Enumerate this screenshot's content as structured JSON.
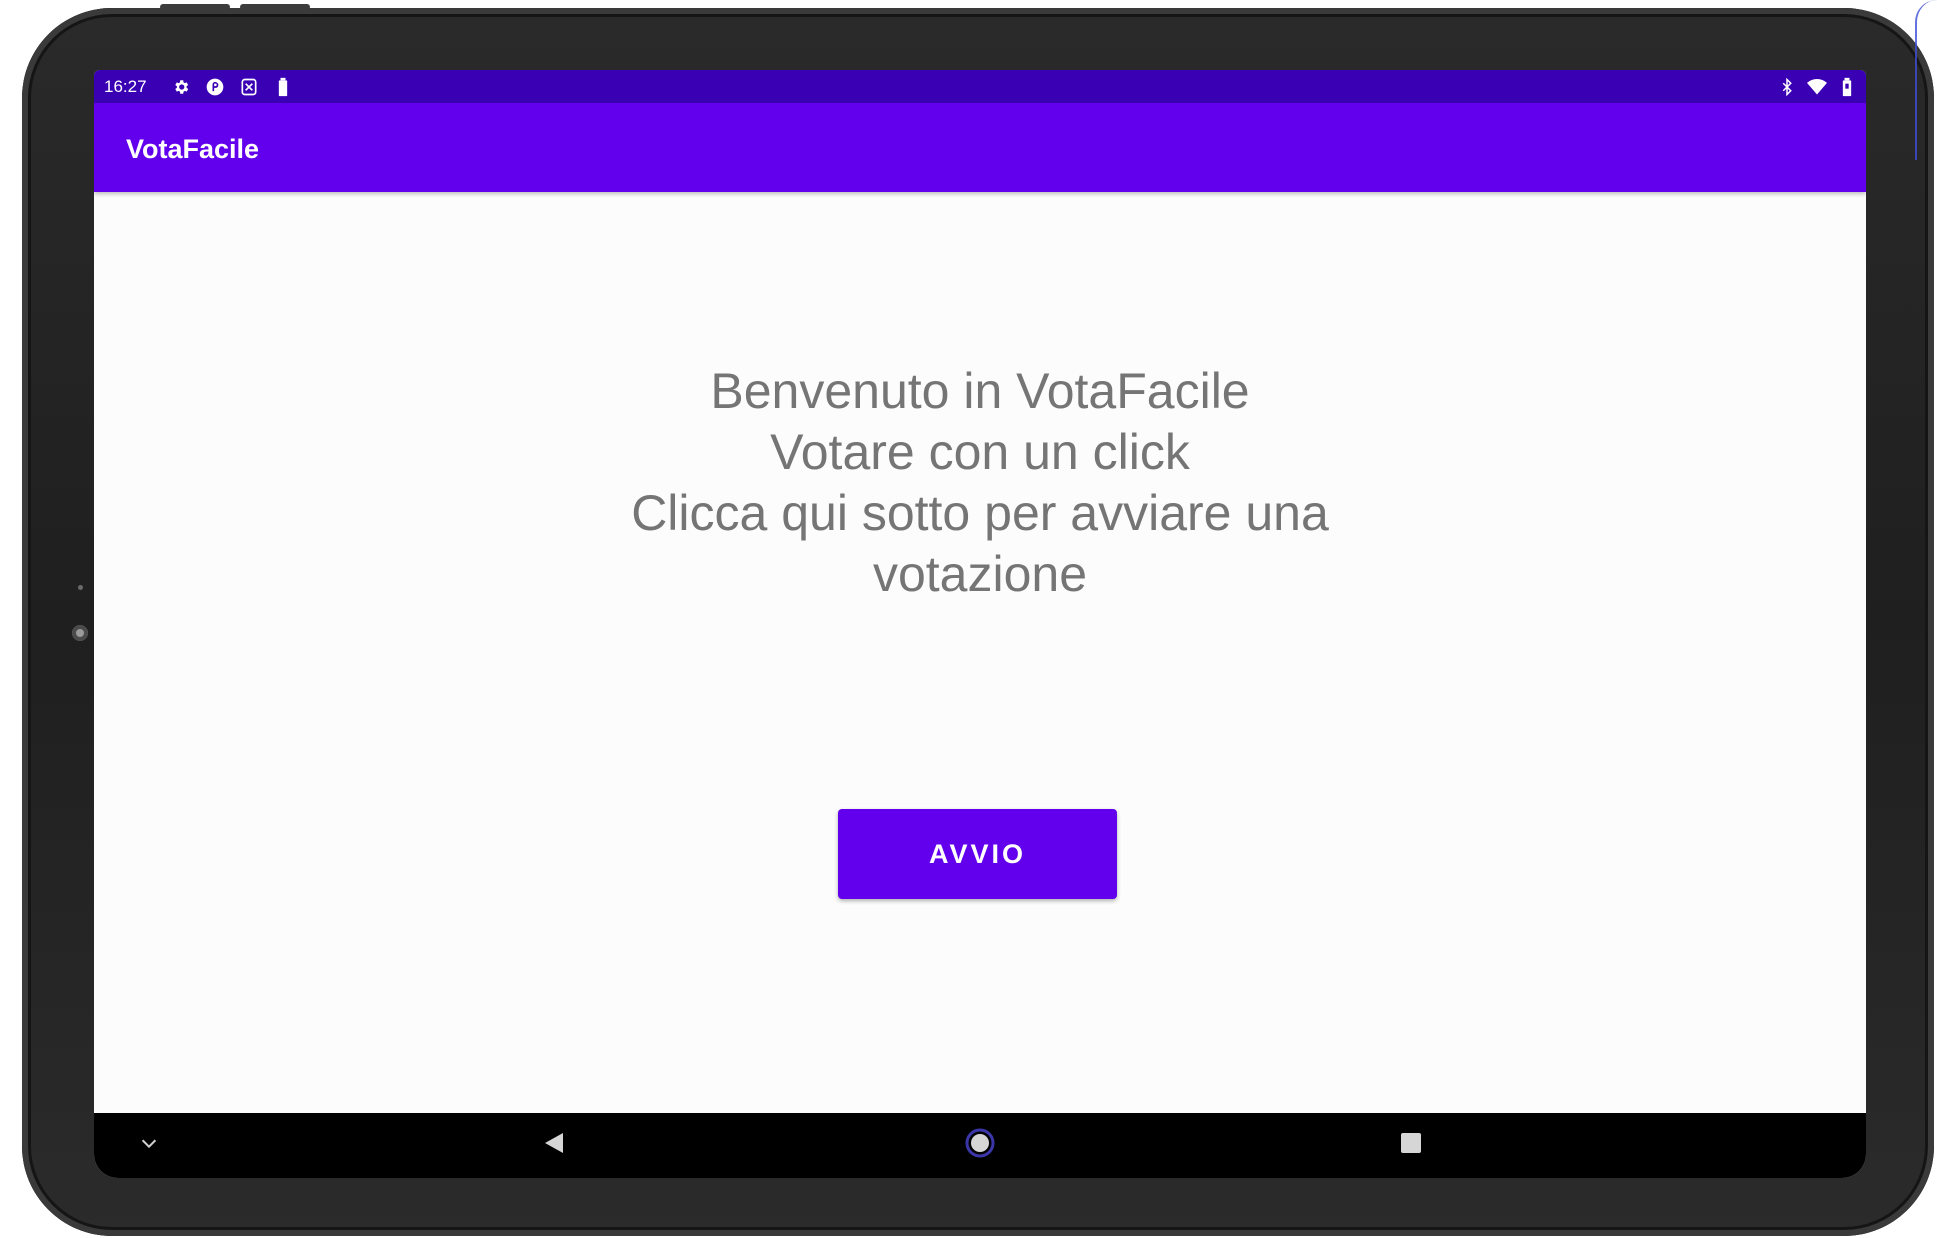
{
  "status_bar": {
    "time": "16:27",
    "left_icons": [
      "settings-icon",
      "shield-icon",
      "sim-icon",
      "battery-alert-icon"
    ],
    "right_icons": [
      "bluetooth-icon",
      "wifi-icon",
      "battery-icon"
    ]
  },
  "app_bar": {
    "title": "VotaFacile"
  },
  "main": {
    "welcome_lines": [
      "Benvenuto in VotaFacile",
      "Votare con un click",
      "Clicca qui sotto per avviare una",
      "votazione"
    ],
    "start_button_label": "AVVIO"
  },
  "nav_bar": {
    "buttons": [
      "collapse-icon",
      "back-icon",
      "home-icon",
      "recents-icon"
    ]
  },
  "colors": {
    "primary": "#6200ee",
    "primary_dark": "#3a00b4",
    "text_secondary": "#757575",
    "background": "#fcfcfc"
  }
}
